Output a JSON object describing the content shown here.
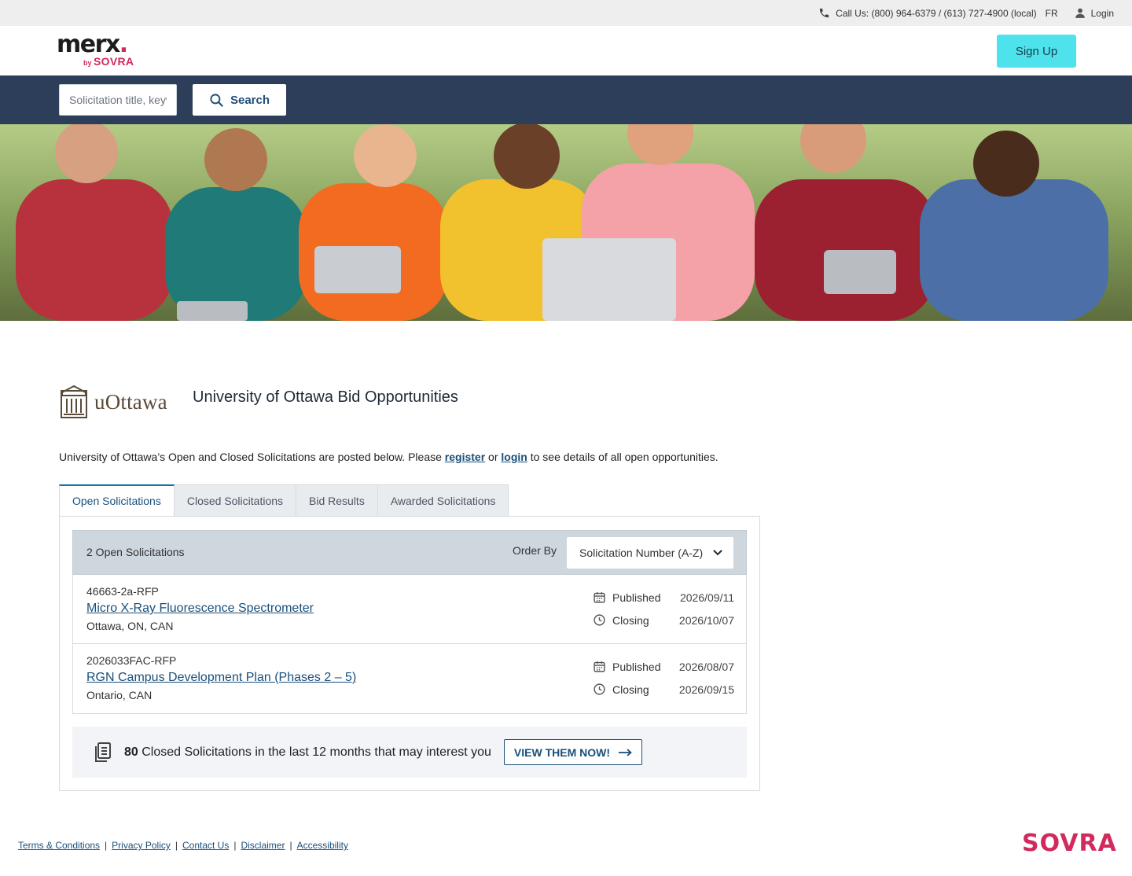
{
  "topbar": {
    "call_text": "Call Us: (800) 964-6379 / (613) 727-4900 (local)",
    "lang": "FR",
    "login": "Login"
  },
  "header": {
    "logo_word": "merx",
    "logo_by": "by",
    "logo_brand": "SOVRA",
    "signup_label": "Sign Up",
    "accent_color": "#4ee3ec",
    "brand_color": "#d12a5c"
  },
  "search": {
    "placeholder": "Solicitation title, keyword, or number",
    "button_label": "Search"
  },
  "org": {
    "logo_text": "uOttawa",
    "title": "University of Ottawa Bid Opportunities",
    "intro_before": "University of Ottawa’s Open and Closed Solicitations are posted below. Please ",
    "register_link": "register",
    "intro_or": " or ",
    "login_link": "login",
    "intro_after": " to see details of all open opportunities."
  },
  "tabs": [
    {
      "label": "Open Solicitations",
      "active": true
    },
    {
      "label": "Closed Solicitations",
      "active": false
    },
    {
      "label": "Bid Results",
      "active": false
    },
    {
      "label": "Awarded Solicitations",
      "active": false
    }
  ],
  "list": {
    "count_label": "2 Open Solicitations",
    "order_by_label": "Order By",
    "order_by_value": "Solicitation Number (A-Z)",
    "published_label": "Published",
    "closing_label": "Closing",
    "rows": [
      {
        "number": "46663-2a-RFP",
        "title": "Micro X-Ray Fluorescence Spectrometer",
        "location": "Ottawa, ON, CAN",
        "published": "2026/09/11",
        "closing": "2026/10/07"
      },
      {
        "number": "2026033FAC-RFP",
        "title": "RGN Campus Development Plan (Phases 2 – 5)",
        "location": "Ontario, CAN",
        "published": "2026/08/07",
        "closing": "2026/09/15"
      }
    ]
  },
  "promo": {
    "count": "80",
    "text": " Closed Solicitations in the last 12 months that may interest you",
    "button_label": "VIEW THEM NOW!"
  },
  "footer": {
    "links": [
      "Terms & Conditions",
      "Privacy Policy",
      "Contact Us",
      "Disclaimer",
      "Accessibility"
    ],
    "brand": "SOVRA"
  }
}
